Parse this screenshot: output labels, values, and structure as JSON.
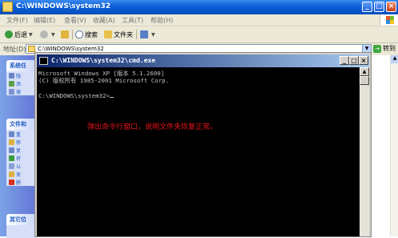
{
  "explorer": {
    "title": "C:\\WINDOWS\\system32",
    "menu": [
      "文件(F)",
      "编辑(E)",
      "查看(V)",
      "收藏(A)",
      "工具(T)",
      "帮助(H)"
    ],
    "toolbar": {
      "back": "后退",
      "search": "搜索",
      "folders": "文件夹"
    },
    "address_label": "地址(D)",
    "address_value": "C:\\WINDOWS\\system32",
    "go_label": "转到",
    "taskpane": {
      "group1_title": "系统任",
      "group1_items": [
        "隐",
        "添",
        "搜"
      ],
      "group2_title": "文件和",
      "group2_items": [
        "重",
        "移",
        "复",
        "将",
        "以",
        "发",
        "删"
      ],
      "group3_title": "其它位"
    }
  },
  "cmd": {
    "title": "C:\\WINDOWS\\system32\\cmd.exe",
    "lines": [
      "Microsoft Windows XP [版本 5.1.2600]",
      "(C) 版权所有 1985-2001 Microsoft Corp.",
      "",
      "C:\\WINDOWS\\system32>"
    ],
    "annotation": "弹出命令行窗口，说明文件夹恢复正常。"
  },
  "colors": {
    "xp_blue": "#0a5fd8",
    "console_bg": "#000000",
    "console_text": "#c0c0c0",
    "annotation": "#e8141c"
  }
}
